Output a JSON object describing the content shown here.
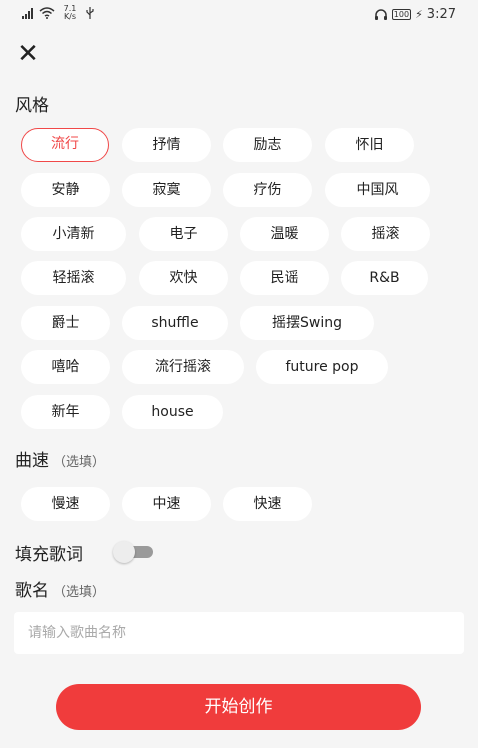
{
  "status_bar": {
    "network_speed": "7.1",
    "network_unit": "K/s",
    "battery": "100",
    "time": "3:27",
    "icons": [
      "signal-icon",
      "wifi-icon",
      "usb-icon",
      "headphones-icon",
      "battery-icon",
      "charging-icon"
    ]
  },
  "close_icon": "✕",
  "style_section": {
    "title": "风格",
    "tags": [
      "流行",
      "抒情",
      "励志",
      "怀旧",
      "安静",
      "寂寞",
      "疗伤",
      "中国风",
      "小清新",
      "电子",
      "温暖",
      "摇滚",
      "轻摇滚",
      "欢快",
      "民谣",
      "R&B",
      "爵士",
      "shuffle",
      "摇摆Swing",
      "嘻哈",
      "流行摇滚",
      "future pop",
      "新年",
      "house"
    ],
    "selected": "流行"
  },
  "tempo_section": {
    "title": "曲速",
    "optional": "（选填）",
    "options": [
      "慢速",
      "中速",
      "快速"
    ]
  },
  "fill_lyrics": {
    "label": "填充歌词",
    "enabled": false
  },
  "song_name": {
    "title": "歌名",
    "optional": "（选填）",
    "placeholder": "请输入歌曲名称",
    "value": ""
  },
  "start_button": "开始创作",
  "colors": {
    "accent": "#f03c3c",
    "selected_chip": "#f04848",
    "background": "#f5f5f5"
  }
}
